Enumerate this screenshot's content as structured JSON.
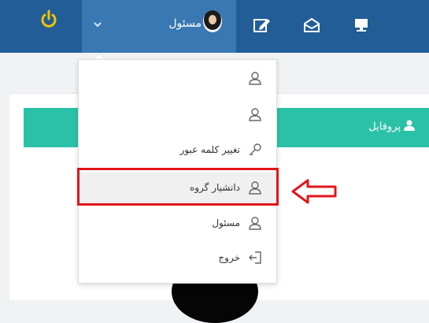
{
  "topbar": {
    "user_name": "مسئول",
    "colors": {
      "bar": "#225d98",
      "active": "#3a78b4",
      "power": "#f2c200"
    },
    "icons": [
      "power-icon",
      "chevron-down-icon",
      "user-avatar",
      "edit-icon",
      "envelope-icon",
      "monitor-icon"
    ]
  },
  "profile": {
    "title": "پروفایل",
    "header_color": "#2bc1a9"
  },
  "menu": {
    "items": [
      {
        "label": "",
        "icon": "user-icon"
      },
      {
        "label": "",
        "icon": "user-icon"
      },
      {
        "label": "تغییر کلمه عبور",
        "icon": "key-icon"
      },
      {
        "label": "دانشیار گروه",
        "icon": "user-icon",
        "highlighted": true
      },
      {
        "label": "مسئول",
        "icon": "user-icon"
      },
      {
        "label": "خروج",
        "icon": "logout-icon"
      }
    ]
  },
  "annotation": {
    "color": "#e0161b"
  }
}
